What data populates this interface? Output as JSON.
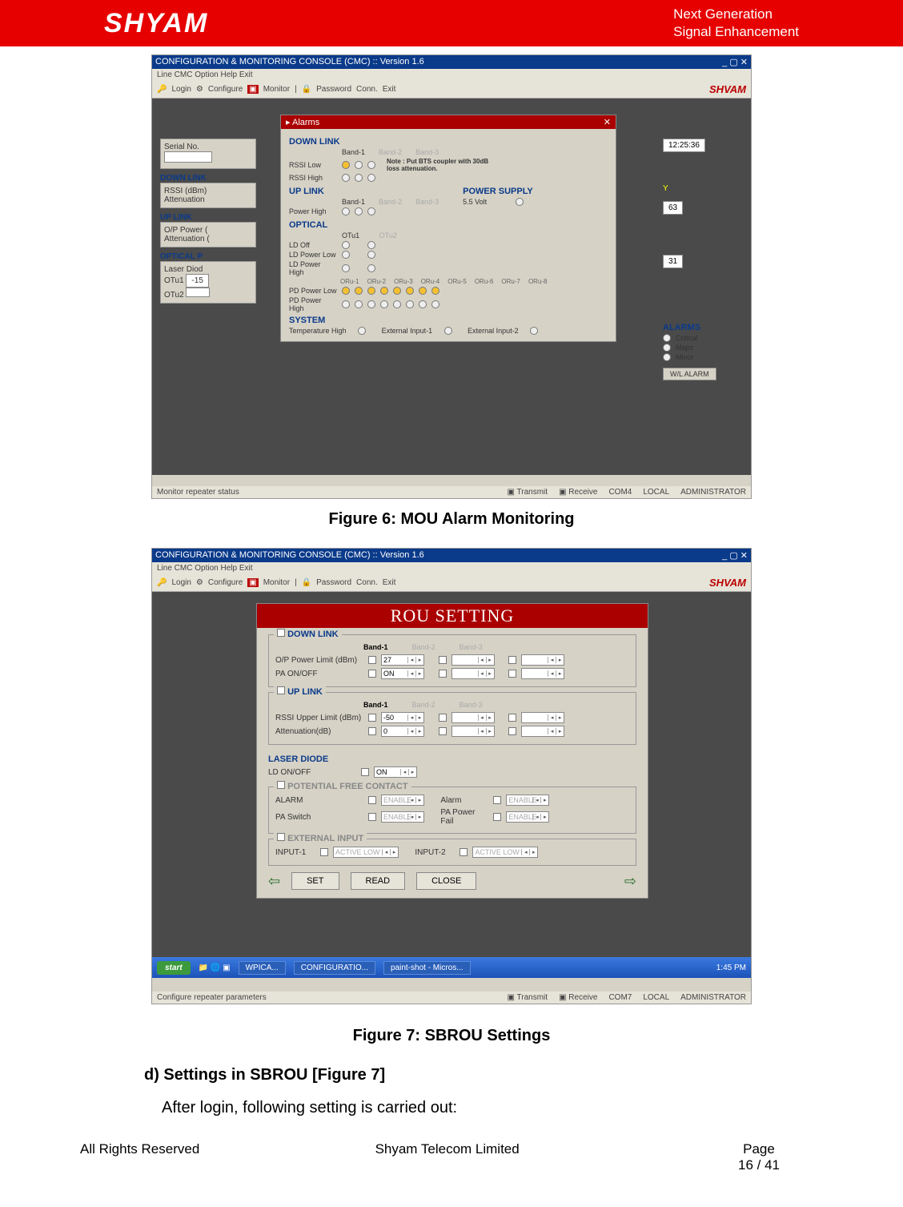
{
  "header": {
    "logo": "SHYAM",
    "tagline1": "Next Generation",
    "tagline2": "Signal Enhancement"
  },
  "fig6": {
    "caption": "Figure 6: MOU Alarm Monitoring",
    "title": "CONFIGURATION & MONITORING CONSOLE (CMC) :: Version 1.6",
    "menu": "Line   CMC   Option   Help   Exit",
    "toolbar": {
      "login": "Login",
      "configure": "Configure",
      "monitor": "Monitor",
      "password": "Password",
      "conn": "Conn.",
      "exit": "Exit",
      "brand": "SHVAM"
    },
    "left": {
      "serial": "Serial No.",
      "downlink_h": "DOWN LINK",
      "rssi": "RSSI (dBm)",
      "att": "Attenuation",
      "uplink_h": "UP LINK",
      "opp": "O/P Power (",
      "att2": "Attenuation (",
      "opt_h": "OPTICAL P",
      "laser": "Laser Diod",
      "otu1": "OTu1",
      "otu1v": "-15",
      "otu2": "OTu2"
    },
    "alarm": {
      "title": "Alarms",
      "downlink": "DOWN LINK",
      "band1": "Band-1",
      "band2": "Band-2",
      "band3": "Band-3",
      "rssilow": "RSSI Low",
      "rssihigh": "RSSI High",
      "note": "Note : Put BTS coupler with 30dB loss attenuation.",
      "uplink": "UP LINK",
      "powerhigh": "Power High",
      "powersupply": "POWER SUPPLY",
      "v55": "5.5 Volt",
      "optical": "OPTICAL",
      "otu1": "OTu1",
      "otu2": "OTu2",
      "ldoff": "LD Off",
      "ldpl": "LD Power Low",
      "ldph": "LD Power High",
      "oru": [
        "ORu-1",
        "ORu-2",
        "ORu-3",
        "ORu-4",
        "ORu-5",
        "ORu-6",
        "ORu-7",
        "ORu-8"
      ],
      "pdpl": "PD Power Low",
      "pdph": "PD Power High",
      "system": "SYSTEM",
      "temp": "Temperature High",
      "ext1": "External Input-1",
      "ext2": "External Input-2"
    },
    "right": {
      "time": "12:25:36",
      "y": "Y",
      "v1": "63",
      "v2": "31",
      "alarms_h": "ALARMS",
      "crit": "Critical",
      "maj": "Major",
      "min": "Minor",
      "wlbtn": "W/L ALARM"
    },
    "status": {
      "left": "Monitor repeater status",
      "transmit": "Transmit",
      "receive": "Receive",
      "com": "COM4",
      "local": "LOCAL",
      "admin": "ADMINISTRATOR"
    }
  },
  "fig7": {
    "caption": "Figure 7: SBROU Settings",
    "title": "CONFIGURATION & MONITORING CONSOLE (CMC) :: Version 1.6",
    "menu": "Line   CMC   Option   Help   Exit",
    "toolbar": {
      "login": "Login",
      "configure": "Configure",
      "monitor": "Monitor",
      "password": "Password",
      "conn": "Conn.",
      "exit": "Exit",
      "brand": "SHVAM"
    },
    "panel_title": "ROU SETTING",
    "downlink": {
      "h": "DOWN LINK",
      "b1": "Band-1",
      "b2": "Band-2",
      "b3": "Band-3",
      "r1": "O/P Power Limit (dBm)",
      "r1v": "27",
      "r2": "PA ON/OFF",
      "r2v": "ON"
    },
    "uplink": {
      "h": "UP LINK",
      "b1": "Band-1",
      "b2": "Band-2",
      "b3": "Band-3",
      "r1": "RSSI Upper Limit (dBm)",
      "r1v": "-50",
      "r2": "Attenuation(dB)",
      "r2v": "0"
    },
    "laser": {
      "h": "LASER DIODE",
      "r1": "LD ON/OFF",
      "r1v": "ON"
    },
    "pfc": {
      "h": "POTENTIAL FREE CONTACT",
      "r1": "ALARM",
      "r2": "PA Switch",
      "r3": "Alarm",
      "r4": "PA Power Fail",
      "en": "ENABLE"
    },
    "ext": {
      "h": "EXTERNAL INPUT",
      "r1": "INPUT-1",
      "r2": "INPUT-2",
      "v": "ACTIVE LOW"
    },
    "btns": {
      "set": "SET",
      "read": "READ",
      "close": "CLOSE"
    },
    "status": {
      "left": "Configure repeater parameters",
      "transmit": "Transmit",
      "receive": "Receive",
      "com": "COM7",
      "local": "LOCAL",
      "admin": "ADMINISTRATOR"
    },
    "taskbar": {
      "start": "start",
      "t1": "WPICA...",
      "t2": "CONFIGURATIO...",
      "t3": "paint-shot - Micros...",
      "clock": "1:45 PM"
    }
  },
  "body": {
    "section": "d) Settings in SBROU [Figure 7]",
    "para": "After login, following setting is carried out:"
  },
  "footer": {
    "left": "All Rights Reserved",
    "mid": "Shyam Telecom Limited",
    "page_lbl": "Page",
    "page": "16 / 41"
  }
}
